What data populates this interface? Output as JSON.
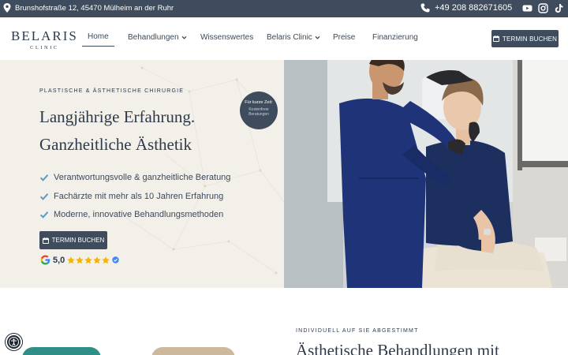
{
  "topbar": {
    "address": "Brunshofstraße 12, 45470 Mülheim an der Ruhr",
    "phone": "+49 208 882671605",
    "socials": [
      "youtube-icon",
      "instagram-icon",
      "tiktok-icon"
    ]
  },
  "logo": {
    "name": "BELARIS",
    "sub": "CLINIC"
  },
  "nav": {
    "home": "Home",
    "treatments": "Behandlungen",
    "knowledge": "Wissenswertes",
    "clinic": "Belaris Clinic",
    "prices": "Preise",
    "financing": "Finanzierung"
  },
  "header_button": "TERMIN BUCHEN",
  "hero": {
    "eyebrow": "PLASTISCHE & ÄSTHETISCHE CHIRURGIE",
    "title_line1": "Langjährige Erfahrung.",
    "title_line2": "Ganzheitliche Ästhetik",
    "badge_title": "Für kurze Zeit:",
    "badge_text_1": "Kostenfreie",
    "badge_text_2": "Beratungen",
    "checks": [
      "Verantwortungsvolle & ganzheitliche Beratung",
      "Fachärzte mit mehr als 10 Jahren Erfahrung",
      "Moderne, innovative Behandlungsmethoden"
    ],
    "button": "TERMIN BUCHEN",
    "rating": "5,0",
    "stars": 5
  },
  "lower": {
    "eyebrow": "INDIVIDUELL AUF SIE ABGESTIMMT",
    "title": "Ästhetische Behandlungen mit"
  },
  "colors": {
    "navy": "#3e4c5d",
    "cream": "#f3efe9",
    "check": "#5b9bc6",
    "star": "#f5b400",
    "scrubs": "#1f3478"
  }
}
